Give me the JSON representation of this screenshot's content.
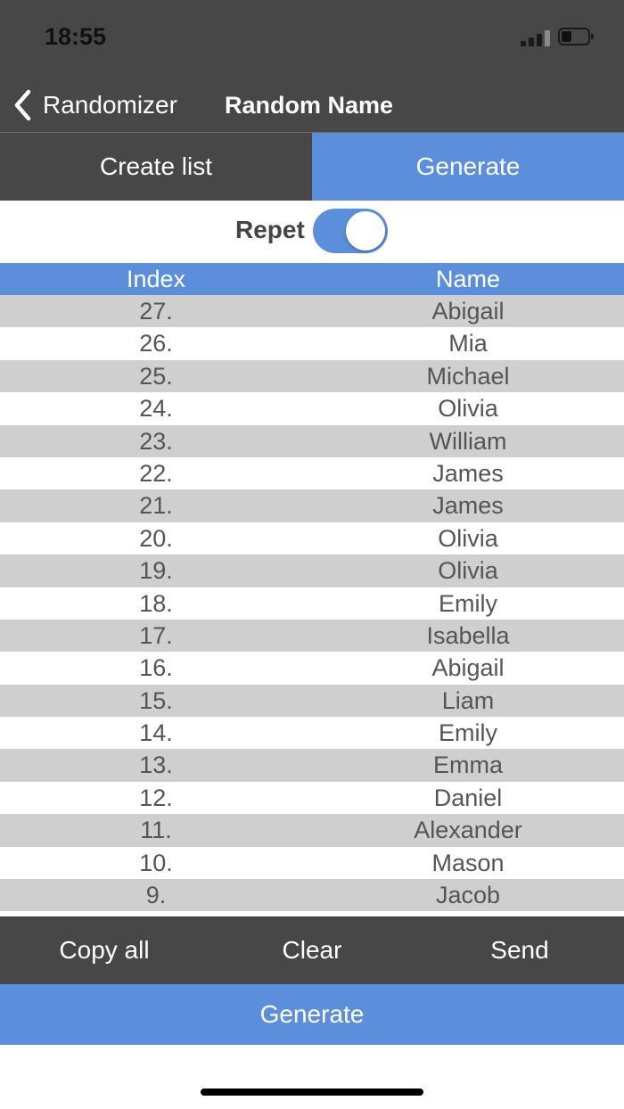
{
  "status_bar": {
    "time": "18:55",
    "signal_icon": "signal-bars-icon",
    "battery_icon": "battery-icon"
  },
  "nav": {
    "back_label": "Randomizer",
    "back_icon": "chevron-left-icon",
    "title": "Random Name"
  },
  "tabs": [
    {
      "label": "Create list",
      "active": false
    },
    {
      "label": "Generate",
      "active": true
    }
  ],
  "repeat": {
    "label": "Repet",
    "enabled": true
  },
  "table": {
    "headers": {
      "index": "Index",
      "name": "Name"
    },
    "rows": [
      {
        "index": "27.",
        "name": "Abigail"
      },
      {
        "index": "26.",
        "name": "Mia"
      },
      {
        "index": "25.",
        "name": "Michael"
      },
      {
        "index": "24.",
        "name": "Olivia"
      },
      {
        "index": "23.",
        "name": "William"
      },
      {
        "index": "22.",
        "name": "James"
      },
      {
        "index": "21.",
        "name": "James"
      },
      {
        "index": "20.",
        "name": "Olivia"
      },
      {
        "index": "19.",
        "name": "Olivia"
      },
      {
        "index": "18.",
        "name": "Emily"
      },
      {
        "index": "17.",
        "name": "Isabella"
      },
      {
        "index": "16.",
        "name": "Abigail"
      },
      {
        "index": "15.",
        "name": "Liam"
      },
      {
        "index": "14.",
        "name": "Emily"
      },
      {
        "index": "13.",
        "name": "Emma"
      },
      {
        "index": "12.",
        "name": "Daniel"
      },
      {
        "index": "11.",
        "name": "Alexander"
      },
      {
        "index": "10.",
        "name": "Mason"
      },
      {
        "index": "9.",
        "name": "Jacob"
      }
    ]
  },
  "actions": {
    "copy_all": "Copy all",
    "clear": "Clear",
    "send": "Send"
  },
  "generate_button": "Generate",
  "colors": {
    "accent": "#5b8fdc",
    "bar": "#474747",
    "row_alt": "#cfcfcf"
  }
}
